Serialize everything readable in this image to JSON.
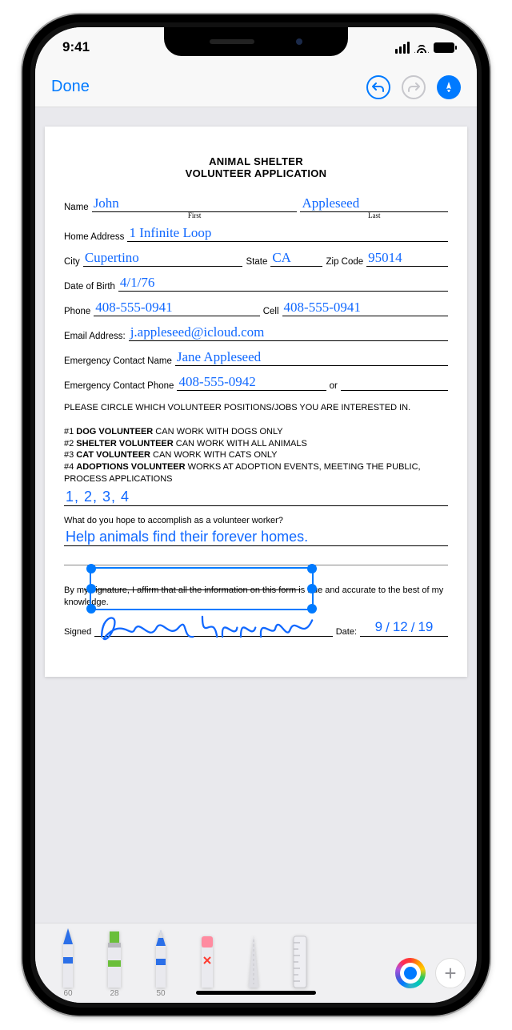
{
  "status": {
    "time": "9:41"
  },
  "nav": {
    "done": "Done"
  },
  "doc": {
    "title_line1": "ANIMAL SHELTER",
    "title_line2": "VOLUNTEER APPLICATION",
    "labels": {
      "name": "Name",
      "first": "First",
      "last": "Last",
      "home_address": "Home Address",
      "city": "City",
      "state": "State",
      "zip": "Zip Code",
      "dob": "Date of Birth",
      "phone": "Phone",
      "cell": "Cell",
      "email": "Email Address:",
      "emg_name": "Emergency Contact Name",
      "emg_phone": "Emergency Contact Phone",
      "or": "or",
      "signed": "Signed",
      "date": "Date:"
    },
    "values": {
      "first": "John",
      "last": "Appleseed",
      "address": "1 Infinite Loop",
      "city": "Cupertino",
      "state": "CA",
      "zip": "95014",
      "dob": "4/1/76",
      "phone": "408-555-0941",
      "cell": "408-555-0941",
      "email": "j.appleseed@icloud.com",
      "emg_name": "Jane Appleseed",
      "emg_phone": "408-555-0942",
      "positions_answer": "1, 2, 3, 4",
      "goal_answer": "Help animals find their forever homes.",
      "sign_date_m": "9",
      "sign_date_d": "12",
      "sign_date_y": "19"
    },
    "instructions": {
      "lead": "PLEASE CIRCLE WHICH VOLUNTEER POSITIONS/JOBS YOU ARE INTERESTED IN.",
      "p1_num": "#1 ",
      "p1_b": "DOG VOLUNTEER",
      "p1_t": " CAN WORK WITH DOGS ONLY",
      "p2_num": "#2 ",
      "p2_b": "SHELTER VOLUNTEER",
      "p2_t": " CAN WORK WITH ALL ANIMALS",
      "p3_num": "#3 ",
      "p3_b": "CAT VOLUNTEER",
      "p3_t": " CAN WORK WITH CATS ONLY",
      "p4_num": "#4 ",
      "p4_b": "ADOPTIONS VOLUNTEER",
      "p4_t": " WORKS AT ADOPTION EVENTS, MEETING THE PUBLIC, PROCESS APPLICATIONS"
    },
    "question": "What do you hope to accomplish as a volunteer worker?",
    "cert_pre": "By m",
    "cert_strike": "y signature, I affirm that all the information on this form i",
    "cert_post": "s true and accurate to the best of my knowledge."
  },
  "tools": {
    "pen_size": "60",
    "highlighter_size": "28",
    "pencil_size": "50"
  }
}
